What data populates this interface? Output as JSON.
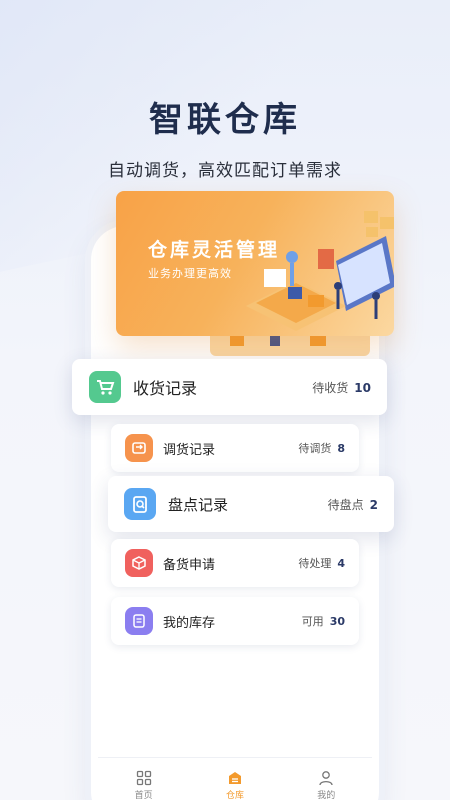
{
  "hero": {
    "title": "智联仓库",
    "subtitle": "自动调货，高效匹配订单需求"
  },
  "banner": {
    "title": "仓库灵活管理",
    "subtitle": "业务办理更高效"
  },
  "records": [
    {
      "label": "收货记录",
      "status": "待收货",
      "count": "10",
      "icon": "cart-icon",
      "color": "#54c98f"
    },
    {
      "label": "调货记录",
      "status": "待调货",
      "count": "8",
      "icon": "transfer-icon",
      "color": "#f6934d"
    },
    {
      "label": "盘点记录",
      "status": "待盘点",
      "count": "2",
      "icon": "clipboard-search-icon",
      "color": "#5aa7f2"
    },
    {
      "label": "备货申请",
      "status": "待处理",
      "count": "4",
      "icon": "box-icon",
      "color": "#f0615e"
    },
    {
      "label": "我的库存",
      "status": "可用",
      "count": "30",
      "icon": "document-icon",
      "color": "#8b7ef0"
    }
  ],
  "tabbar": {
    "items": [
      {
        "label": "首页",
        "icon": "grid-icon"
      },
      {
        "label": "仓库",
        "icon": "warehouse-icon"
      },
      {
        "label": "我的",
        "icon": "user-icon"
      }
    ],
    "active_color": "#f39a2d"
  }
}
